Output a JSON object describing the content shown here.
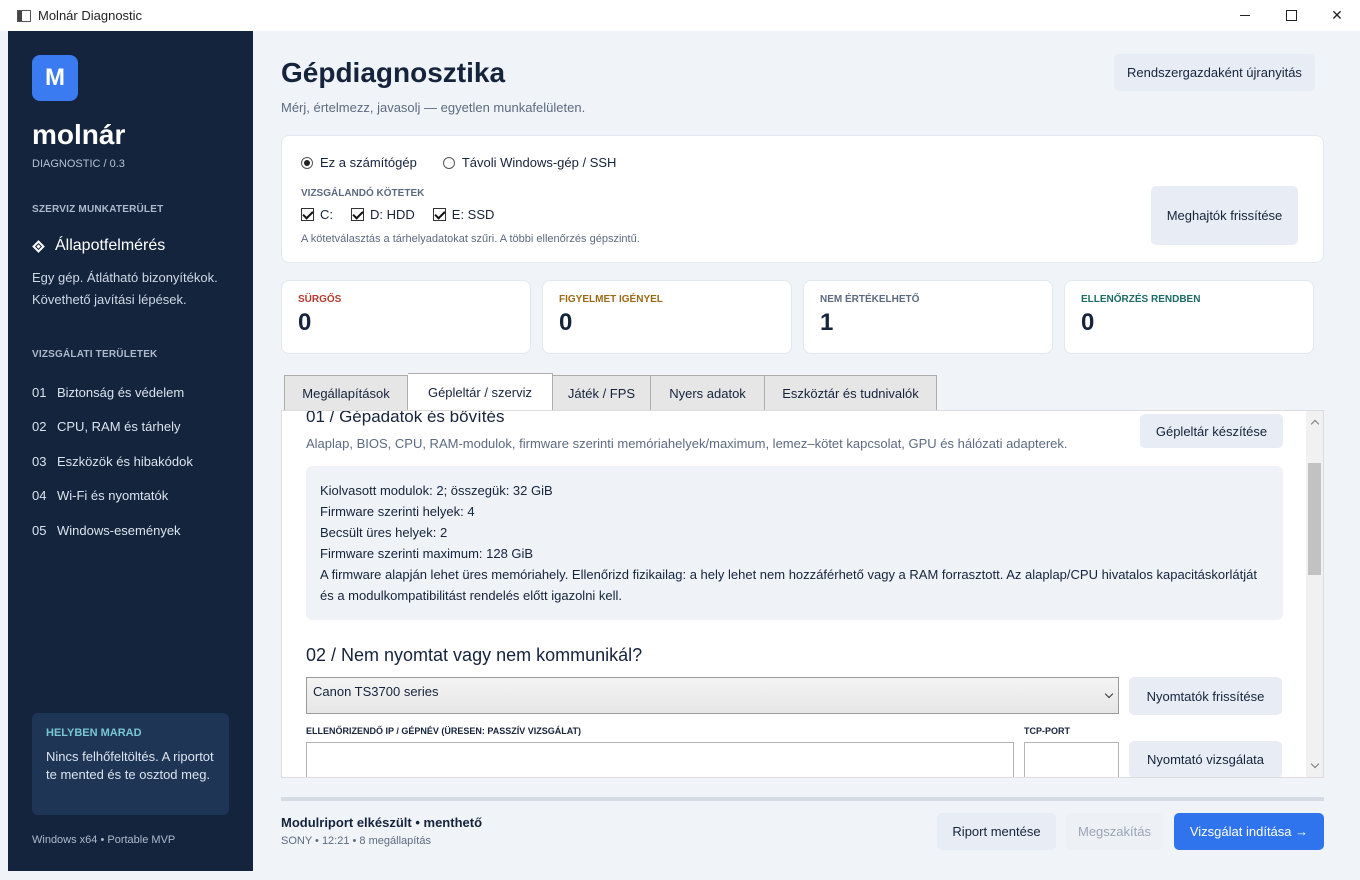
{
  "window": {
    "title": "Molnár Diagnostic"
  },
  "sidebar": {
    "logo_letter": "M",
    "brand": "molnár",
    "brand_sub": "DIAGNOSTIC / 0.3",
    "workspace_label": "SZERVIZ MUNKATERÜLET",
    "active_item": "Állapotfelmérés",
    "description": "Egy gép. Átlátható bizonyítékok. Követhető javítási lépések.",
    "areas_label": "VIZSGÁLATI TERÜLETEK",
    "items": [
      {
        "num": "01",
        "label": "Biztonság és védelem"
      },
      {
        "num": "02",
        "label": "CPU, RAM és tárhely"
      },
      {
        "num": "03",
        "label": "Eszközök és hibakódok"
      },
      {
        "num": "04",
        "label": "Wi-Fi és nyomtatók"
      },
      {
        "num": "05",
        "label": "Windows-események"
      }
    ],
    "local_card": {
      "title": "HELYBEN MARAD",
      "text": "Nincs felhőfeltöltés. A riportot te mented és te osztod meg."
    },
    "footer": "Windows x64 • Portable MVP"
  },
  "header": {
    "title": "Gépdiagnosztika",
    "subtitle": "Mérj, értelmezz, javasolj — egyetlen munkafelületen.",
    "restart_button": "Rendszergazdaként újranyitás"
  },
  "target": {
    "radio_local": "Ez a számítógép",
    "radio_remote": "Távoli Windows-gép / SSH",
    "volumes_label": "VIZSGÁLANDÓ KÖTETEK",
    "volumes": [
      "C:",
      "D:  HDD",
      "E:  SSD"
    ],
    "note": "A kötetválasztás a tárhelyadatokat szűri. A többi ellenőrzés gépszintű.",
    "refresh_drives": "Meghajtók frissítése"
  },
  "stats": [
    {
      "label": "SÜRGŐS",
      "value": "0",
      "color": "#b23b2e"
    },
    {
      "label": "FIGYELMET IGÉNYEL",
      "value": "0",
      "color": "#9a6a16"
    },
    {
      "label": "NEM ÉRTÉKELHETŐ",
      "value": "1",
      "color": "#5c6b80"
    },
    {
      "label": "ELLENŐRZÉS RENDBEN",
      "value": "0",
      "color": "#1c6b63"
    }
  ],
  "tabs": [
    "Megállapítások",
    "Gépleltár / szerviz",
    "Játék / FPS",
    "Nyers adatok",
    "Eszköztár és tudnivalók"
  ],
  "panel": {
    "sec1_title": "01 / Gépadatok és bővítés",
    "sec1_sub": "Alaplap, BIOS, CPU, RAM-modulok, firmware szerinti memóriahelyek/maximum, lemez–kötet kapcsolat, GPU és hálózati adapterek.",
    "inventory_button": "Gépleltár készítése",
    "info_lines": [
      "Kiolvasott modulok: 2; összegük: 32 GiB",
      "Firmware szerinti helyek: 4",
      "Becsült üres helyek: 2",
      "Firmware szerinti maximum: 128 GiB",
      "A firmware alapján lehet üres memóriahely. Ellenőrizd fizikailag: a hely lehet nem hozzáférhető vagy a RAM forrasztott. Az alaplap/CPU hivatalos kapacitáskorlátját és a modulkompatibilitást rendelés előtt igazolni kell."
    ],
    "sec2_title": "02 / Nem nyomtat vagy nem kommunikál?",
    "printer_selected": "Canon TS3700 series",
    "refresh_printers": "Nyomtatók frissítése",
    "ip_label": "ELLENŐRIZENDŐ IP / GÉPNÉV (ÜRESEN: PASSZÍV VIZSGÁLAT)",
    "port_label": "TCP-PORT",
    "ip_value": "",
    "port_value": "",
    "printer_test": "Nyomtató vizsgálata"
  },
  "footer": {
    "status_title": "Modulriport elkészült • menthető",
    "status_sub": "SONY • 12:21 • 8 megállapítás",
    "save": "Riport mentése",
    "cancel": "Megszakítás",
    "start": "Vizsgálat indítása →"
  }
}
